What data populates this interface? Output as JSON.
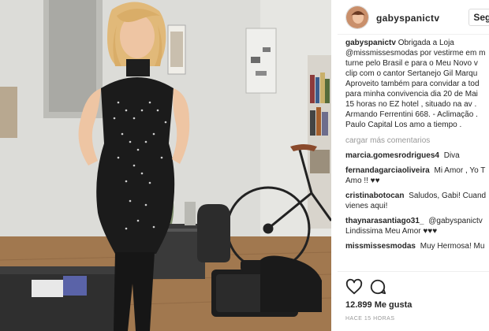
{
  "post": {
    "username": "gabyspanictv",
    "follow_label": "Seguir",
    "caption": {
      "username": "gabyspanictv",
      "lines": [
        "Obrigada a Loja",
        "@missmissesmodas por vestirme em m",
        "turne pelo Brasil e para o Meu Novo v",
        "clip com o cantor Sertanejo Gil Marqu",
        "Aproveito também para convidar a tod",
        "para minha convivencia dia 20 de Mai",
        "15 horas no EZ hotel , situado na av .",
        "Armando Ferrentini 668. - Aclimação .",
        "Paulo Capital Los amo a tiempo ."
      ]
    },
    "load_more": "cargar más comentarios",
    "comments": [
      {
        "user": "marcia.gomesrodrigues4",
        "lines": [
          "Diva"
        ]
      },
      {
        "user": "fernandagarciaoliveira",
        "lines": [
          "Mi Amor , Yo T",
          "Amo !! ♥♥"
        ]
      },
      {
        "user": "cristinabotocan",
        "lines": [
          "Saludos, Gabi! Cuand",
          "vienes aqui!"
        ]
      },
      {
        "user": "thaynarasantiago31_",
        "lines": [
          "@gabyspanictv",
          "Lindissima Meu Amor ♥♥♥"
        ]
      },
      {
        "user": "missmissesmodas",
        "lines": [
          "Muy Hermosa! Mu"
        ]
      }
    ],
    "likes": "12.899 Me gusta",
    "time": "HACE 15 HORAS",
    "icons": [
      "heart-icon",
      "comment-icon"
    ]
  }
}
